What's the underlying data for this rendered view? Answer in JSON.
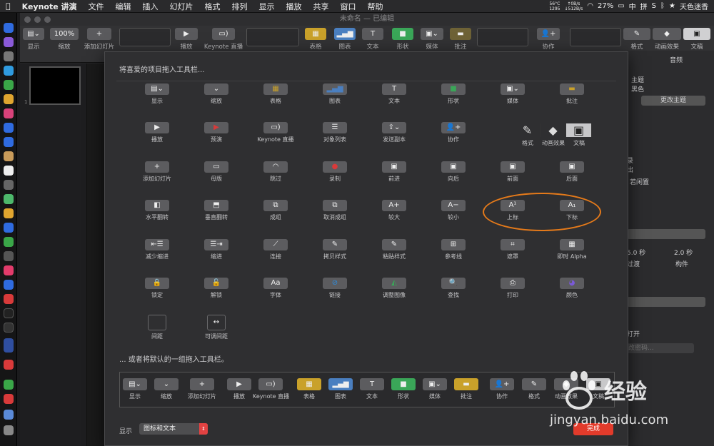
{
  "menubar": {
    "app": "Keynote 讲演",
    "menus": [
      "文件",
      "编辑",
      "插入",
      "幻灯片",
      "格式",
      "排列",
      "显示",
      "播放",
      "共享",
      "窗口",
      "帮助"
    ],
    "temp": "56°C",
    "rpm": "1295",
    "up": "↑0B/s",
    "down": "↓512B/s",
    "battery": "27%",
    "input_a": "中",
    "input_b": "拼",
    "user": "天色迷香"
  },
  "window": {
    "title": "未命名 — 已编辑"
  },
  "toolbar": {
    "view": "显示",
    "zoom_value": "100%",
    "zoom": "缩放",
    "add_slide": "添加幻灯片",
    "play": "播放",
    "keynote_live": "Keynote 直播",
    "table": "表格",
    "chart": "图表",
    "text": "文本",
    "shape": "形状",
    "media": "媒体",
    "comment": "批注",
    "collaborate": "协作",
    "format": "格式",
    "animate": "动画效果",
    "document": "文稿"
  },
  "navigator": {
    "slide_number": "1"
  },
  "inspector": {
    "tab_audio": "音频",
    "theme_label": "主题",
    "theme_value": "黑色",
    "change_theme": "更改主题",
    "row_a": "录",
    "row_b": "出",
    "row_c": "若闲置",
    "duration_a": "5.0 秒",
    "duration_b": "2.0 秒",
    "transition": "过渡",
    "build": "构件",
    "open": "打开",
    "password": "改密码..."
  },
  "sheet": {
    "drag_hint": "将喜爱的项目拖入工具栏...",
    "default_hint": "... 或者将默认的一组拖入工具栏。",
    "items": [
      {
        "label": "显示",
        "icon": "view-icon",
        "glyph": "▤⌄"
      },
      {
        "label": "缩放",
        "icon": "zoom-icon",
        "glyph": "⌄"
      },
      {
        "label": "表格",
        "icon": "table-icon",
        "glyph": "▦"
      },
      {
        "label": "图表",
        "icon": "chart-icon",
        "glyph": "▂▄▆"
      },
      {
        "label": "文本",
        "icon": "text-icon",
        "glyph": "T"
      },
      {
        "label": "形状",
        "icon": "shape-icon",
        "glyph": "■"
      },
      {
        "label": "媒体",
        "icon": "media-icon",
        "glyph": "▣⌄"
      },
      {
        "label": "批注",
        "icon": "comment-icon",
        "glyph": "▬"
      },
      {
        "label": "播放",
        "icon": "play-icon",
        "glyph": "▶"
      },
      {
        "label": "预演",
        "icon": "rehearse-icon",
        "glyph": "▶"
      },
      {
        "label": "Keynote 直播",
        "icon": "keynote-live-icon",
        "glyph": "▭)"
      },
      {
        "label": "对象列表",
        "icon": "object-list-icon",
        "glyph": "☰"
      },
      {
        "label": "发送副本",
        "icon": "send-copy-icon",
        "glyph": "⇪⌄"
      },
      {
        "label": "协作",
        "icon": "collaborate-icon",
        "glyph": "👤+"
      },
      {
        "label": "添加幻灯片",
        "icon": "add-slide-icon",
        "glyph": "+"
      },
      {
        "label": "母版",
        "icon": "master-icon",
        "glyph": "▭"
      },
      {
        "label": "跳过",
        "icon": "skip-icon",
        "glyph": "◠"
      },
      {
        "label": "录制",
        "icon": "record-icon",
        "glyph": "●"
      },
      {
        "label": "前进",
        "icon": "forward-icon",
        "glyph": "▣"
      },
      {
        "label": "向后",
        "icon": "backward-icon",
        "glyph": "▣"
      },
      {
        "label": "前面",
        "icon": "front-icon",
        "glyph": "▣"
      },
      {
        "label": "后面",
        "icon": "back-icon",
        "glyph": "▣"
      },
      {
        "label": "水平翻转",
        "icon": "flip-horizontal-icon",
        "glyph": "◧"
      },
      {
        "label": "垂直翻转",
        "icon": "flip-vertical-icon",
        "glyph": "⬒"
      },
      {
        "label": "成组",
        "icon": "group-icon",
        "glyph": "⧉"
      },
      {
        "label": "取消成组",
        "icon": "ungroup-icon",
        "glyph": "⧉"
      },
      {
        "label": "较大",
        "icon": "bigger-icon",
        "glyph": "A+"
      },
      {
        "label": "较小",
        "icon": "smaller-icon",
        "glyph": "A−"
      },
      {
        "label": "上标",
        "icon": "superscript-icon",
        "glyph": "A¹"
      },
      {
        "label": "下标",
        "icon": "subscript-icon",
        "glyph": "A₁"
      },
      {
        "label": "减少缩进",
        "icon": "decrease-indent-icon",
        "glyph": "⇤☰"
      },
      {
        "label": "缩进",
        "icon": "indent-icon",
        "glyph": "☰⇥"
      },
      {
        "label": "连接",
        "icon": "connect-icon",
        "glyph": "⟋"
      },
      {
        "label": "拷贝样式",
        "icon": "copy-style-icon",
        "glyph": "✎"
      },
      {
        "label": "粘贴样式",
        "icon": "paste-style-icon",
        "glyph": "✎"
      },
      {
        "label": "参考线",
        "icon": "guides-icon",
        "glyph": "⊞"
      },
      {
        "label": "遮罩",
        "icon": "mask-icon",
        "glyph": "⌗"
      },
      {
        "label": "即时 Alpha",
        "icon": "instant-alpha-icon",
        "glyph": "▦"
      },
      {
        "label": "锁定",
        "icon": "lock-icon",
        "glyph": "🔒"
      },
      {
        "label": "解锁",
        "icon": "unlock-icon",
        "glyph": "🔓"
      },
      {
        "label": "字体",
        "icon": "fonts-icon",
        "glyph": "Aa"
      },
      {
        "label": "链接",
        "icon": "link-icon",
        "glyph": "⊘"
      },
      {
        "label": "调整图像",
        "icon": "adjust-image-icon",
        "glyph": "◭"
      },
      {
        "label": "查找",
        "icon": "find-icon",
        "glyph": "🔍"
      },
      {
        "label": "打印",
        "icon": "print-icon",
        "glyph": "⎙"
      },
      {
        "label": "颜色",
        "icon": "colors-icon",
        "glyph": "◕"
      },
      {
        "label": "间距",
        "icon": "space-icon",
        "glyph": ""
      },
      {
        "label": "可调间距",
        "icon": "flexible-space-icon",
        "glyph": "↔"
      }
    ],
    "format_group": {
      "format": "格式",
      "animate": "动画效果",
      "document": "文稿"
    },
    "default_set": [
      {
        "label": "显示",
        "icon": "view-icon",
        "glyph": "▤⌄"
      },
      {
        "label": "缩放",
        "icon": "zoom-icon",
        "glyph": "⌄"
      },
      {
        "label": "添加幻灯片",
        "icon": "add-slide-icon",
        "glyph": "+"
      },
      {
        "label": "播放",
        "icon": "play-icon",
        "glyph": "▶"
      },
      {
        "label": "Keynote 直播",
        "icon": "keynote-live-icon",
        "glyph": "▭)"
      },
      {
        "label": "表格",
        "icon": "table-icon",
        "glyph": "▦"
      },
      {
        "label": "图表",
        "icon": "chart-icon",
        "glyph": "▂▄▆"
      },
      {
        "label": "文本",
        "icon": "text-icon",
        "glyph": "T"
      },
      {
        "label": "形状",
        "icon": "shape-icon",
        "glyph": "■"
      },
      {
        "label": "媒体",
        "icon": "media-icon",
        "glyph": "▣⌄"
      },
      {
        "label": "批注",
        "icon": "comment-icon",
        "glyph": "▬"
      },
      {
        "label": "协作",
        "icon": "collaborate-icon",
        "glyph": "👤+"
      },
      {
        "label": "格式",
        "icon": "format-icon",
        "glyph": "✎"
      },
      {
        "label": "动画效果",
        "icon": "animate-icon",
        "glyph": "◆"
      },
      {
        "label": "文稿",
        "icon": "document-icon",
        "glyph": "▣"
      }
    ],
    "show_label": "显示",
    "show_value": "图标和文本",
    "done": "完成"
  },
  "watermark": {
    "brand": "经验",
    "url": "jingyan.baidu.com"
  },
  "colors": {
    "accent_red": "#e23b2b",
    "highlight_orange": "#e57a1a"
  }
}
